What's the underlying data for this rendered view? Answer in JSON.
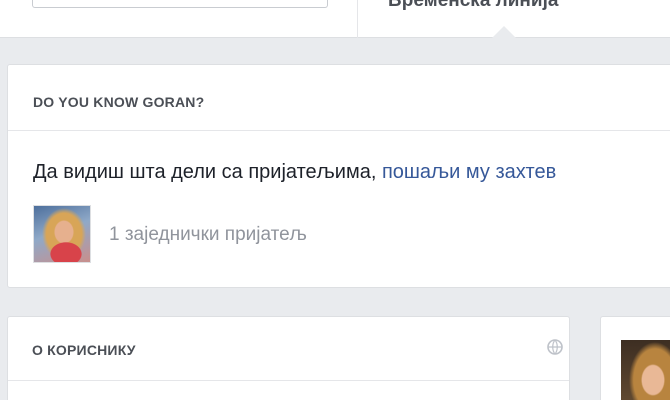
{
  "header": {
    "timeline_tab_label": "Временска линија"
  },
  "know_card": {
    "title": "DO YOU KNOW GORAN?",
    "message_text": "Да видиш шта дели са пријатељима, ",
    "send_request_link": "пошаљи му захтев",
    "mutual_friends_label": "1 заједнички пријатељ"
  },
  "about_card": {
    "title": "О КОРИСНИКУ"
  },
  "colors": {
    "page_background": "#e9ebee",
    "card_background": "#ffffff",
    "link": "#365899",
    "heading": "#4b4f56",
    "muted_text": "#90949c"
  }
}
